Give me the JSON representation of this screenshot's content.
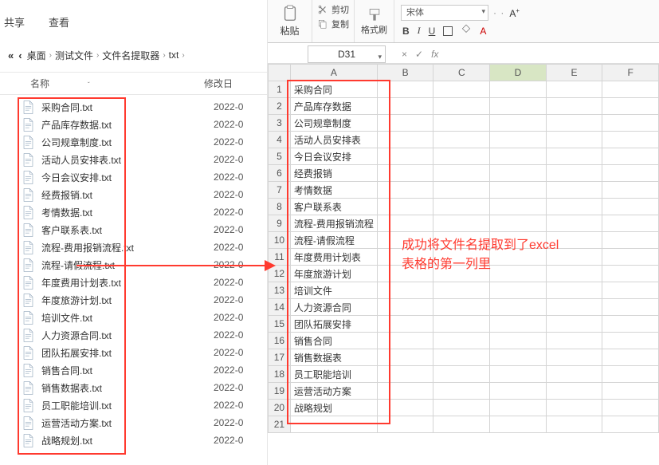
{
  "explorer": {
    "top_menu": {
      "share": "共享",
      "view": "查看"
    },
    "back_label": "«",
    "fwd_label": "‹",
    "breadcrumb": [
      "桌面",
      "测试文件",
      "文件名提取器",
      "txt"
    ],
    "col_name": "名称",
    "col_date": "修改日",
    "date_prefix": "2022-0",
    "files": [
      "采购合同.txt",
      "产品库存数据.txt",
      "公司规章制度.txt",
      "活动人员安排表.txt",
      "今日会议安排.txt",
      "经费报销.txt",
      "考情数据.txt",
      "客户联系表.txt",
      "流程-费用报销流程.txt",
      "流程-请假流程.txt",
      "年度费用计划表.txt",
      "年度旅游计划.txt",
      "培训文件.txt",
      "人力资源合同.txt",
      "团队拓展安排.txt",
      "销售合同.txt",
      "销售数据表.txt",
      "员工职能培训.txt",
      "运营活动方案.txt",
      "战略规划.txt"
    ]
  },
  "excel": {
    "ribbon": {
      "paste": "粘贴",
      "cut": "剪切",
      "copy": "复制",
      "format_painter": "格式刷",
      "font_name": "宋体",
      "letters": {
        "B": "B",
        "I": "I",
        "U": "U",
        "A": "A"
      }
    },
    "name_box": "D31",
    "fx_label": "fx",
    "check": "✓",
    "cross": "×",
    "cols": [
      "A",
      "B",
      "C",
      "D",
      "E",
      "F"
    ],
    "selected_col": "D",
    "rows_data": [
      "采购合同",
      "产品库存数据",
      "公司规章制度",
      "活动人员安排表",
      "今日会议安排",
      "经费报销",
      "考情数据",
      "客户联系表",
      "流程-费用报销流程",
      "流程-请假流程",
      "年度费用计划表",
      "年度旅游计划",
      "培训文件",
      "人力资源合同",
      "团队拓展安排",
      "销售合同",
      "销售数据表",
      "员工职能培训",
      "运营活动方案",
      "战略规划"
    ],
    "extra_rows": 1,
    "annotation_line1": "成功将文件名提取到了excel",
    "annotation_line2": "表格的第一列里"
  },
  "colors": {
    "highlight": "#ff3a2f"
  }
}
